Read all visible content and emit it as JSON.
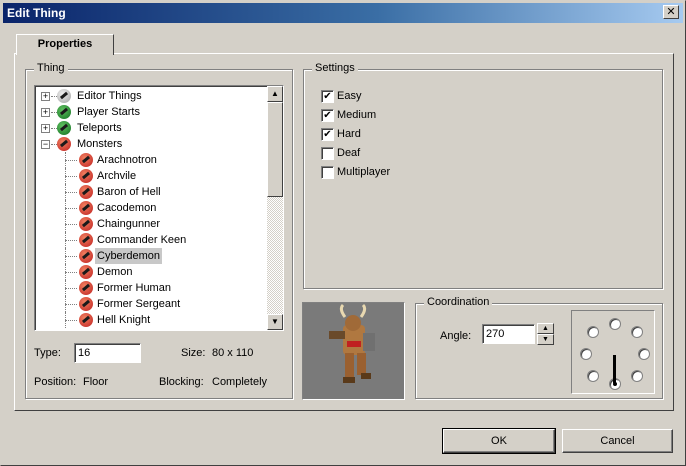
{
  "window": {
    "title": "Edit Thing",
    "close_glyph": "✕"
  },
  "tabs": [
    {
      "label": "Properties",
      "active": true
    }
  ],
  "thing": {
    "group_label": "Thing",
    "tree": [
      {
        "label": "Editor Things",
        "level": 0,
        "expander": "+",
        "icon": "gray"
      },
      {
        "label": "Player Starts",
        "level": 0,
        "expander": "+",
        "icon": "green"
      },
      {
        "label": "Teleports",
        "level": 0,
        "expander": "+",
        "icon": "green"
      },
      {
        "label": "Monsters",
        "level": 0,
        "expander": "−",
        "icon": "red"
      },
      {
        "label": "Arachnotron",
        "level": 1,
        "icon": "red"
      },
      {
        "label": "Archvile",
        "level": 1,
        "icon": "red"
      },
      {
        "label": "Baron of Hell",
        "level": 1,
        "icon": "red"
      },
      {
        "label": "Cacodemon",
        "level": 1,
        "icon": "red"
      },
      {
        "label": "Chaingunner",
        "level": 1,
        "icon": "red"
      },
      {
        "label": "Commander Keen",
        "level": 1,
        "icon": "red"
      },
      {
        "label": "Cyberdemon",
        "level": 1,
        "icon": "red",
        "selected": true
      },
      {
        "label": "Demon",
        "level": 1,
        "icon": "red"
      },
      {
        "label": "Former Human",
        "level": 1,
        "icon": "red"
      },
      {
        "label": "Former Sergeant",
        "level": 1,
        "icon": "red"
      },
      {
        "label": "Hell Knight",
        "level": 1,
        "icon": "red"
      }
    ],
    "type_label": "Type:",
    "type_value": "16",
    "size_label": "Size:",
    "size_value": "80 x 110",
    "position_label": "Position:",
    "position_value": "Floor",
    "blocking_label": "Blocking:",
    "blocking_value": "Completely"
  },
  "settings": {
    "group_label": "Settings",
    "flags": [
      {
        "label": "Easy",
        "checked": true
      },
      {
        "label": "Medium",
        "checked": true
      },
      {
        "label": "Hard",
        "checked": true
      },
      {
        "label": "Deaf",
        "checked": false
      },
      {
        "label": "Multiplayer",
        "checked": false
      }
    ]
  },
  "coordination": {
    "group_label": "Coordination",
    "angle_label": "Angle:",
    "angle_value": "270",
    "angle_selected": 270
  },
  "buttons": {
    "ok": "OK",
    "cancel": "Cancel"
  },
  "icons": {
    "check": "✔",
    "scroll_up": "▲",
    "scroll_down": "▼",
    "spin_up": "▲",
    "spin_down": "▼"
  }
}
